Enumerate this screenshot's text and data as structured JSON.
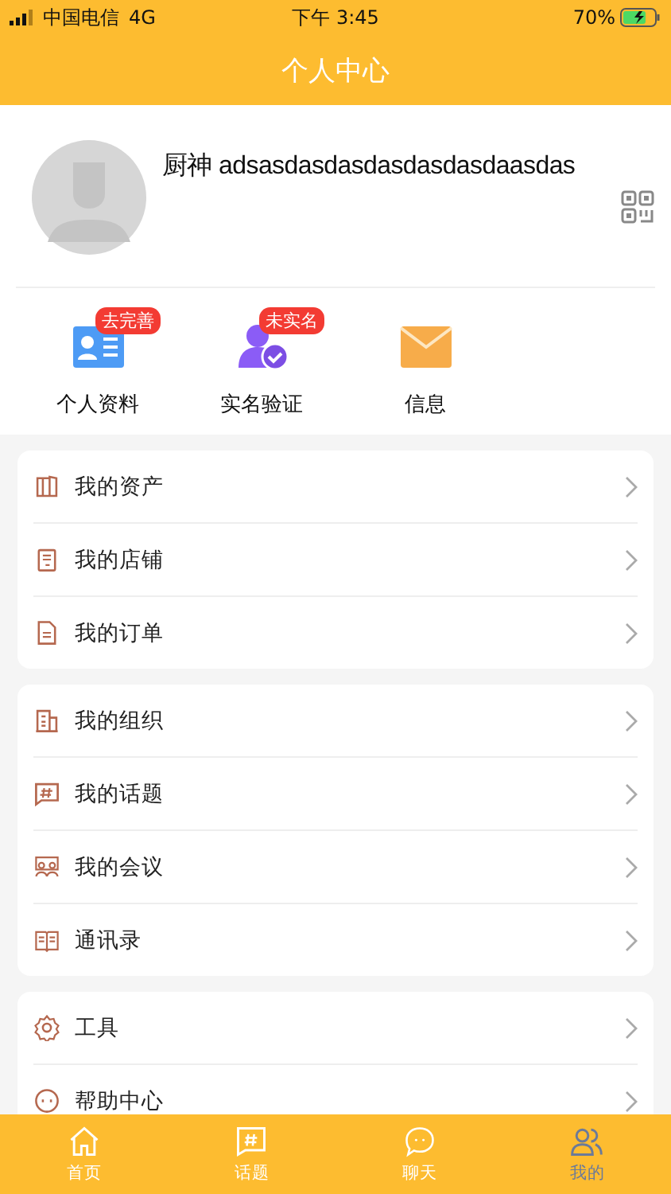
{
  "status_bar": {
    "carrier": "中国电信",
    "network": "4G",
    "time": "下午 3:45",
    "battery_percent": "70%"
  },
  "nav_bar": {
    "title": "个人中心"
  },
  "profile": {
    "name": "厨神 adsasdasdasdasdasdasdaasdas"
  },
  "shortcuts": [
    {
      "label": "个人资料",
      "badge": "去完善"
    },
    {
      "label": "实名验证",
      "badge": "未实名"
    },
    {
      "label": "信息"
    }
  ],
  "menu_groups": [
    {
      "items": [
        {
          "label": "我的资产"
        },
        {
          "label": "我的店铺"
        },
        {
          "label": "我的订单"
        }
      ]
    },
    {
      "items": [
        {
          "label": "我的组织"
        },
        {
          "label": "我的话题"
        },
        {
          "label": "我的会议"
        },
        {
          "label": "通讯录"
        }
      ]
    },
    {
      "items": [
        {
          "label": "工具"
        },
        {
          "label": "帮助中心"
        }
      ]
    }
  ],
  "tab_bar": [
    {
      "label": "首页",
      "selected": false
    },
    {
      "label": "话题",
      "selected": false
    },
    {
      "label": "聊天",
      "selected": false
    },
    {
      "label": "我的",
      "selected": true
    }
  ]
}
